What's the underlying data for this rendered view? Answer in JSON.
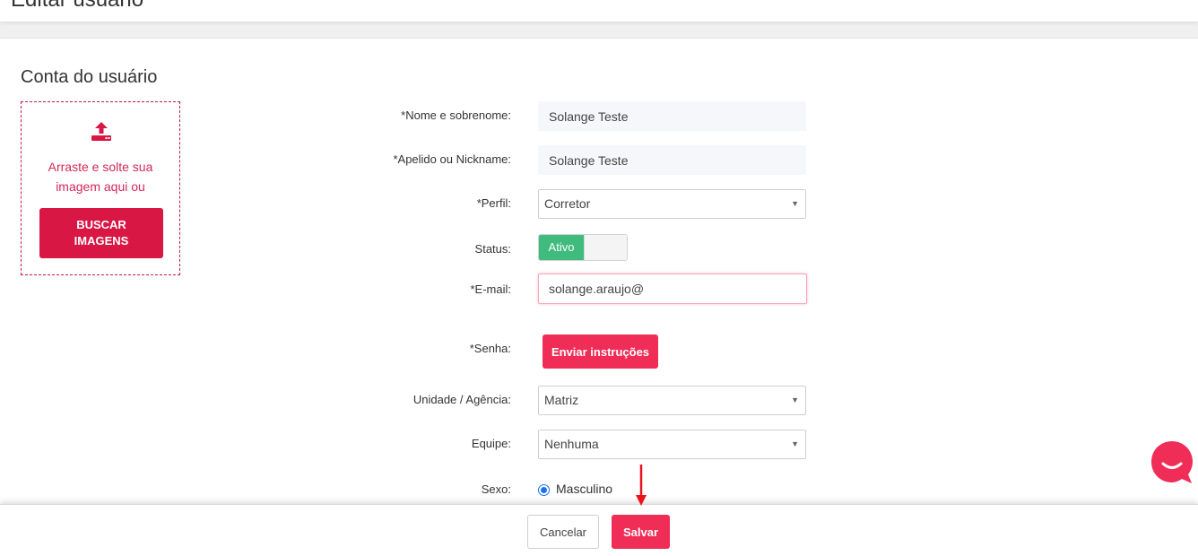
{
  "header": {
    "title": "Editar usuário"
  },
  "section": {
    "title": "Conta do usuário"
  },
  "dropzone": {
    "text_line1": "Arraste e solte sua",
    "text_line2": "imagem aqui ou",
    "button_line1": "BUSCAR",
    "button_line2": "IMAGENS"
  },
  "form": {
    "name": {
      "label": "*Nome e sobrenome:",
      "value": "Solange Teste"
    },
    "nickname": {
      "label": "*Apelido ou Nickname:",
      "value": "Solange Teste"
    },
    "profile": {
      "label": "*Perfil:",
      "value": "Corretor"
    },
    "status": {
      "label": "Status:",
      "value": "Ativo"
    },
    "email": {
      "label": "*E-mail:",
      "value": "solange.araujo@"
    },
    "password": {
      "label": "*Senha:",
      "button": "Enviar instruções"
    },
    "unit": {
      "label": "Unidade / Agência:",
      "value": "Matriz"
    },
    "team": {
      "label": "Equipe:",
      "value": "Nenhuma"
    },
    "sex": {
      "label": "Sexo:",
      "value": "Masculino"
    }
  },
  "footer": {
    "cancel": "Cancelar",
    "save": "Salvar"
  },
  "icons": {
    "upload": "upload-icon",
    "select_arrow": "▼",
    "chat": "chat-icon",
    "arrow": "arrow-down-icon"
  },
  "colors": {
    "primary": "#ef2d56",
    "dropzone_border": "#c2184b",
    "active": "#3fbb7d",
    "radio": "#1a73e8"
  }
}
